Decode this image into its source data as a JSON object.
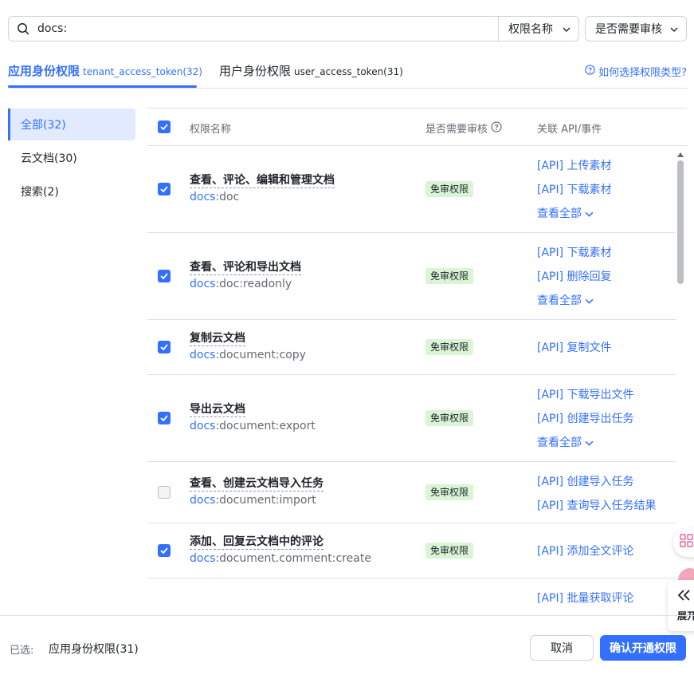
{
  "search": {
    "value": "docs:",
    "icon": "search-icon"
  },
  "filters": {
    "field_select": "权限名称",
    "review_select": "是否需要审核"
  },
  "tabs": {
    "tenant": {
      "label": "应用身份权限",
      "token": "tenant_access_token(32)"
    },
    "user": {
      "label": "用户身份权限",
      "token": "user_access_token(31)"
    },
    "help": "如何选择权限类型?"
  },
  "sidebar": {
    "items": [
      {
        "label": "全部(32)",
        "active": true
      },
      {
        "label": "云文档(30)",
        "active": false
      },
      {
        "label": "搜索(2)",
        "active": false
      }
    ]
  },
  "table": {
    "headers": {
      "name": "权限名称",
      "review": "是否需要审核",
      "api": "关联 API/事件"
    },
    "rows": [
      {
        "checked": true,
        "name": "查看、评论、编辑和管理文档",
        "scope_prefix": "docs",
        "scope_rest": ":doc",
        "badge": "免审权限",
        "apis": [
          "[API] 上传素材",
          "[API] 下载素材"
        ],
        "view_all": "查看全部"
      },
      {
        "checked": true,
        "name": "查看、评论和导出文档",
        "scope_prefix": "docs",
        "scope_rest": ":doc:readonly",
        "badge": "免审权限",
        "apis": [
          "[API] 下载素材",
          "[API] 删除回复"
        ],
        "view_all": "查看全部"
      },
      {
        "checked": true,
        "name": "复制云文档",
        "scope_prefix": "docs",
        "scope_rest": ":document:copy",
        "badge": "免审权限",
        "apis": [
          "[API] 复制文件"
        ],
        "view_all": ""
      },
      {
        "checked": true,
        "name": "导出云文档",
        "scope_prefix": "docs",
        "scope_rest": ":document:export",
        "badge": "免审权限",
        "apis": [
          "[API] 下载导出文件",
          "[API] 创建导出任务"
        ],
        "view_all": "查看全部"
      },
      {
        "checked": false,
        "name": "查看、创建云文档导入任务",
        "scope_prefix": "docs",
        "scope_rest": ":document:import",
        "badge": "免审权限",
        "apis": [
          "[API] 创建导入任务",
          "[API] 查询导入任务结果"
        ],
        "view_all": ""
      },
      {
        "checked": true,
        "name": "添加、回复云文档中的评论",
        "scope_prefix": "docs",
        "scope_rest": ":document.comment:create",
        "badge": "免审权限",
        "apis": [
          "[API] 添加全文评论"
        ],
        "view_all": ""
      },
      {
        "checked": false,
        "name": "",
        "scope_prefix": "",
        "scope_rest": "",
        "badge": "",
        "apis": [
          "[API] 批量获取评论"
        ],
        "view_all": ""
      }
    ]
  },
  "floating": {
    "expand_label": "展开"
  },
  "footer": {
    "selected_label": "已选:",
    "selected_value": "应用身份权限(31)",
    "cancel": "取消",
    "confirm": "确认开通权限"
  },
  "colors": {
    "accent": "#3370ff",
    "badge_bg": "#d9f5d6",
    "active_bg": "#e1eaff"
  }
}
